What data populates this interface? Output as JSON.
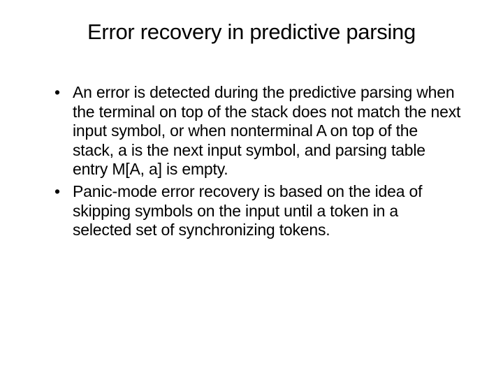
{
  "title": "Error recovery in predictive parsing",
  "bullets": [
    "An error is detected during the predictive parsing when the terminal on top of the stack does not match the next input symbol, or when nonterminal A on top of the stack, a is the next input symbol, and parsing table entry M[A, a] is empty.",
    "Panic-mode error recovery is based on the idea of skipping symbols on the input until a token in a selected set of synchronizing tokens."
  ]
}
